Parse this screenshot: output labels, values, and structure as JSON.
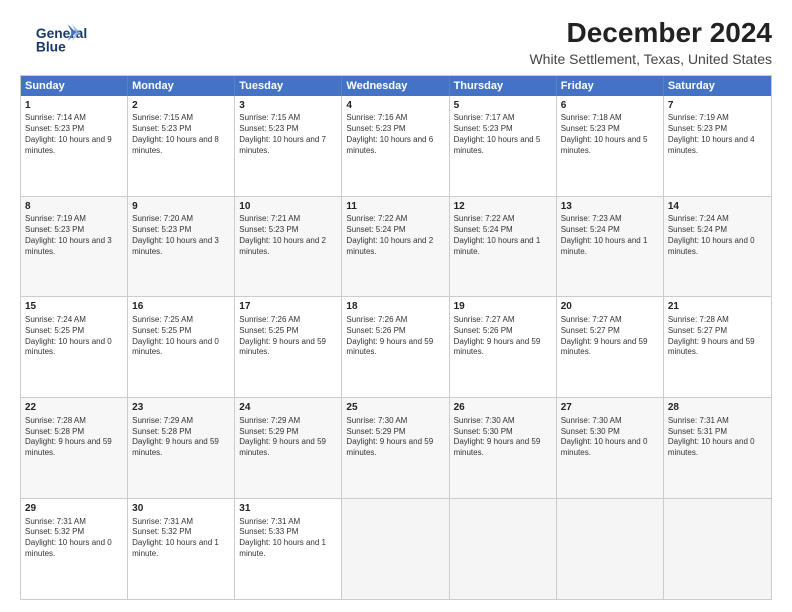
{
  "header": {
    "logo_line1": "General",
    "logo_line2": "Blue",
    "month": "December 2024",
    "location": "White Settlement, Texas, United States"
  },
  "weekdays": [
    "Sunday",
    "Monday",
    "Tuesday",
    "Wednesday",
    "Thursday",
    "Friday",
    "Saturday"
  ],
  "rows": [
    [
      {
        "day": "1",
        "rise": "7:14 AM",
        "set": "5:23 PM",
        "daylight": "10 hours and 9 minutes."
      },
      {
        "day": "2",
        "rise": "7:15 AM",
        "set": "5:23 PM",
        "daylight": "10 hours and 8 minutes."
      },
      {
        "day": "3",
        "rise": "7:15 AM",
        "set": "5:23 PM",
        "daylight": "10 hours and 7 minutes."
      },
      {
        "day": "4",
        "rise": "7:16 AM",
        "set": "5:23 PM",
        "daylight": "10 hours and 6 minutes."
      },
      {
        "day": "5",
        "rise": "7:17 AM",
        "set": "5:23 PM",
        "daylight": "10 hours and 5 minutes."
      },
      {
        "day": "6",
        "rise": "7:18 AM",
        "set": "5:23 PM",
        "daylight": "10 hours and 5 minutes."
      },
      {
        "day": "7",
        "rise": "7:19 AM",
        "set": "5:23 PM",
        "daylight": "10 hours and 4 minutes."
      }
    ],
    [
      {
        "day": "8",
        "rise": "7:19 AM",
        "set": "5:23 PM",
        "daylight": "10 hours and 3 minutes."
      },
      {
        "day": "9",
        "rise": "7:20 AM",
        "set": "5:23 PM",
        "daylight": "10 hours and 3 minutes."
      },
      {
        "day": "10",
        "rise": "7:21 AM",
        "set": "5:23 PM",
        "daylight": "10 hours and 2 minutes."
      },
      {
        "day": "11",
        "rise": "7:22 AM",
        "set": "5:24 PM",
        "daylight": "10 hours and 2 minutes."
      },
      {
        "day": "12",
        "rise": "7:22 AM",
        "set": "5:24 PM",
        "daylight": "10 hours and 1 minute."
      },
      {
        "day": "13",
        "rise": "7:23 AM",
        "set": "5:24 PM",
        "daylight": "10 hours and 1 minute."
      },
      {
        "day": "14",
        "rise": "7:24 AM",
        "set": "5:24 PM",
        "daylight": "10 hours and 0 minutes."
      }
    ],
    [
      {
        "day": "15",
        "rise": "7:24 AM",
        "set": "5:25 PM",
        "daylight": "10 hours and 0 minutes."
      },
      {
        "day": "16",
        "rise": "7:25 AM",
        "set": "5:25 PM",
        "daylight": "10 hours and 0 minutes."
      },
      {
        "day": "17",
        "rise": "7:26 AM",
        "set": "5:25 PM",
        "daylight": "9 hours and 59 minutes."
      },
      {
        "day": "18",
        "rise": "7:26 AM",
        "set": "5:26 PM",
        "daylight": "9 hours and 59 minutes."
      },
      {
        "day": "19",
        "rise": "7:27 AM",
        "set": "5:26 PM",
        "daylight": "9 hours and 59 minutes."
      },
      {
        "day": "20",
        "rise": "7:27 AM",
        "set": "5:27 PM",
        "daylight": "9 hours and 59 minutes."
      },
      {
        "day": "21",
        "rise": "7:28 AM",
        "set": "5:27 PM",
        "daylight": "9 hours and 59 minutes."
      }
    ],
    [
      {
        "day": "22",
        "rise": "7:28 AM",
        "set": "5:28 PM",
        "daylight": "9 hours and 59 minutes."
      },
      {
        "day": "23",
        "rise": "7:29 AM",
        "set": "5:28 PM",
        "daylight": "9 hours and 59 minutes."
      },
      {
        "day": "24",
        "rise": "7:29 AM",
        "set": "5:29 PM",
        "daylight": "9 hours and 59 minutes."
      },
      {
        "day": "25",
        "rise": "7:30 AM",
        "set": "5:29 PM",
        "daylight": "9 hours and 59 minutes."
      },
      {
        "day": "26",
        "rise": "7:30 AM",
        "set": "5:30 PM",
        "daylight": "9 hours and 59 minutes."
      },
      {
        "day": "27",
        "rise": "7:30 AM",
        "set": "5:30 PM",
        "daylight": "10 hours and 0 minutes."
      },
      {
        "day": "28",
        "rise": "7:31 AM",
        "set": "5:31 PM",
        "daylight": "10 hours and 0 minutes."
      }
    ],
    [
      {
        "day": "29",
        "rise": "7:31 AM",
        "set": "5:32 PM",
        "daylight": "10 hours and 0 minutes."
      },
      {
        "day": "30",
        "rise": "7:31 AM",
        "set": "5:32 PM",
        "daylight": "10 hours and 1 minute."
      },
      {
        "day": "31",
        "rise": "7:31 AM",
        "set": "5:33 PM",
        "daylight": "10 hours and 1 minute."
      },
      null,
      null,
      null,
      null
    ]
  ],
  "labels": {
    "sunrise": "Sunrise:",
    "sunset": "Sunset:",
    "daylight": "Daylight:"
  }
}
